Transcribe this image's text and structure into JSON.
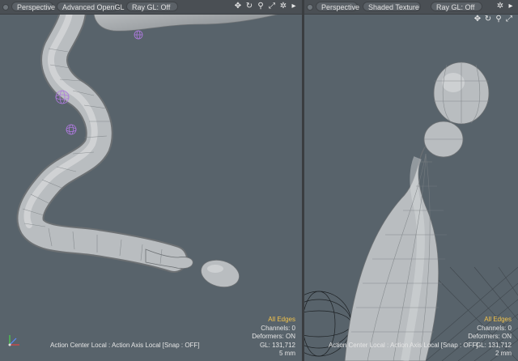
{
  "left_viewport": {
    "tabs": [
      "Perspective",
      "Advanced OpenGL",
      "Ray GL: Off"
    ],
    "selection_mode": "All Edges",
    "channels": "Channels: 0",
    "deformers": "Deformers: ON",
    "gl_count": "GL: 131,712",
    "scale": "5 mm",
    "status": "Action Center Local : Action Axis Local  [Snap : OFF]"
  },
  "right_viewport": {
    "tabs": [
      "Perspective",
      "Shaded Texture",
      "Ray GL: Off"
    ],
    "selection_mode": "All Edges",
    "channels": "Channels: 0",
    "deformers": "Deformers: ON",
    "gl_count": "GL: 131,712",
    "scale": "2 mm",
    "status": "Action Center Local : Action Axis Local  [Snap : OFF]"
  },
  "icons": [
    "move-icon",
    "rotate-icon",
    "zoom-icon",
    "fit-icon",
    "settings-icon",
    "arrow-icon"
  ],
  "colors": {
    "viewport_bg": "#58636b",
    "highlight": "#f3c34a",
    "mesh": "#a9adb0",
    "locator": "#b07ae0"
  }
}
